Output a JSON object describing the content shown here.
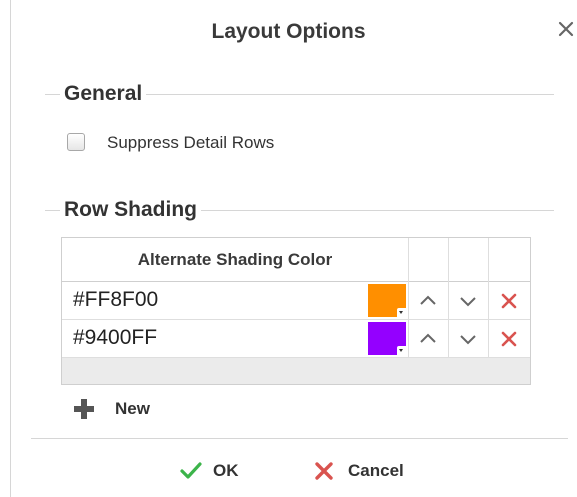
{
  "dialog": {
    "title": "Layout Options",
    "close_icon": "close-icon"
  },
  "general": {
    "legend": "General",
    "suppress_detail_rows": {
      "label": "Suppress Detail Rows",
      "checked": false
    }
  },
  "row_shading": {
    "legend": "Row Shading",
    "column_header": "Alternate Shading Color",
    "rows": [
      {
        "hex": "#FF8F00",
        "color": "#FF8F00"
      },
      {
        "hex": "#9400FF",
        "color": "#9400FF"
      }
    ],
    "icons": {
      "up": "chevron-up-icon",
      "down": "chevron-down-icon",
      "delete": "delete-x-icon"
    },
    "delete_color": "#d9534f"
  },
  "new_button": {
    "label": "New",
    "icon": "plus-icon"
  },
  "actions": {
    "ok": {
      "label": "OK",
      "icon": "check-icon",
      "color": "#3cb44a"
    },
    "cancel": {
      "label": "Cancel",
      "icon": "x-icon",
      "color": "#d9534f"
    }
  }
}
